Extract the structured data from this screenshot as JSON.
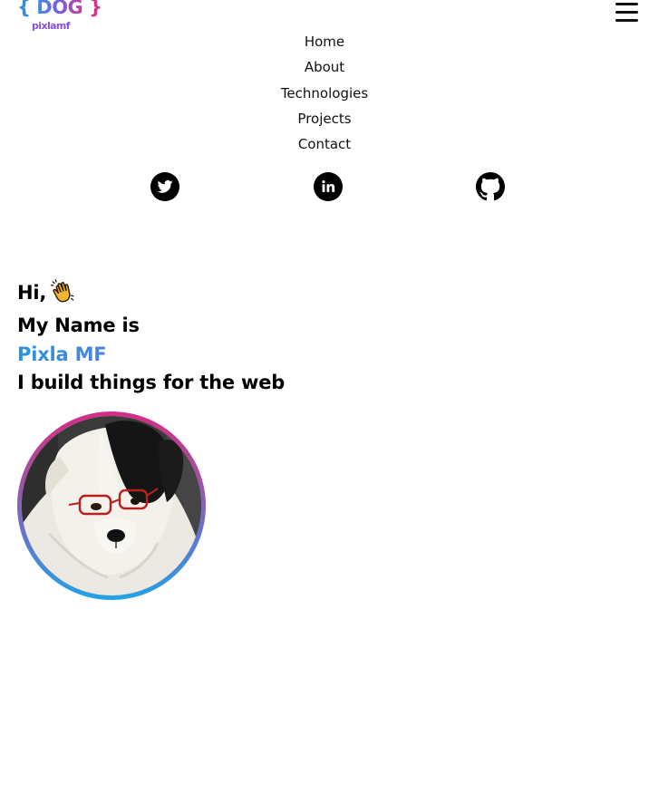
{
  "logo": {
    "left_brace": "{",
    "word": "DOG",
    "right_brace": "}",
    "subtitle": "pixlamf"
  },
  "menu": {
    "icon": "hamburger-menu-icon"
  },
  "nav": {
    "items": [
      {
        "label": "Home"
      },
      {
        "label": "About"
      },
      {
        "label": "Technologies"
      },
      {
        "label": "Projects"
      },
      {
        "label": "Contact"
      }
    ]
  },
  "socials": [
    {
      "icon": "twitter-icon"
    },
    {
      "icon": "linkedin-icon"
    },
    {
      "icon": "github-icon"
    }
  ],
  "hero": {
    "greeting": "Hi,",
    "greeting_emoji": "waving-hand-icon",
    "intro": "My Name is",
    "name": "Pixla MF",
    "tagline": "I build things for the web"
  },
  "avatar": {
    "icon": "dog-with-glasses-photo"
  },
  "colors": {
    "brand_blue": "#2795e1",
    "brand_purple": "#9a5ae6",
    "brand_pink": "#d52d86"
  }
}
